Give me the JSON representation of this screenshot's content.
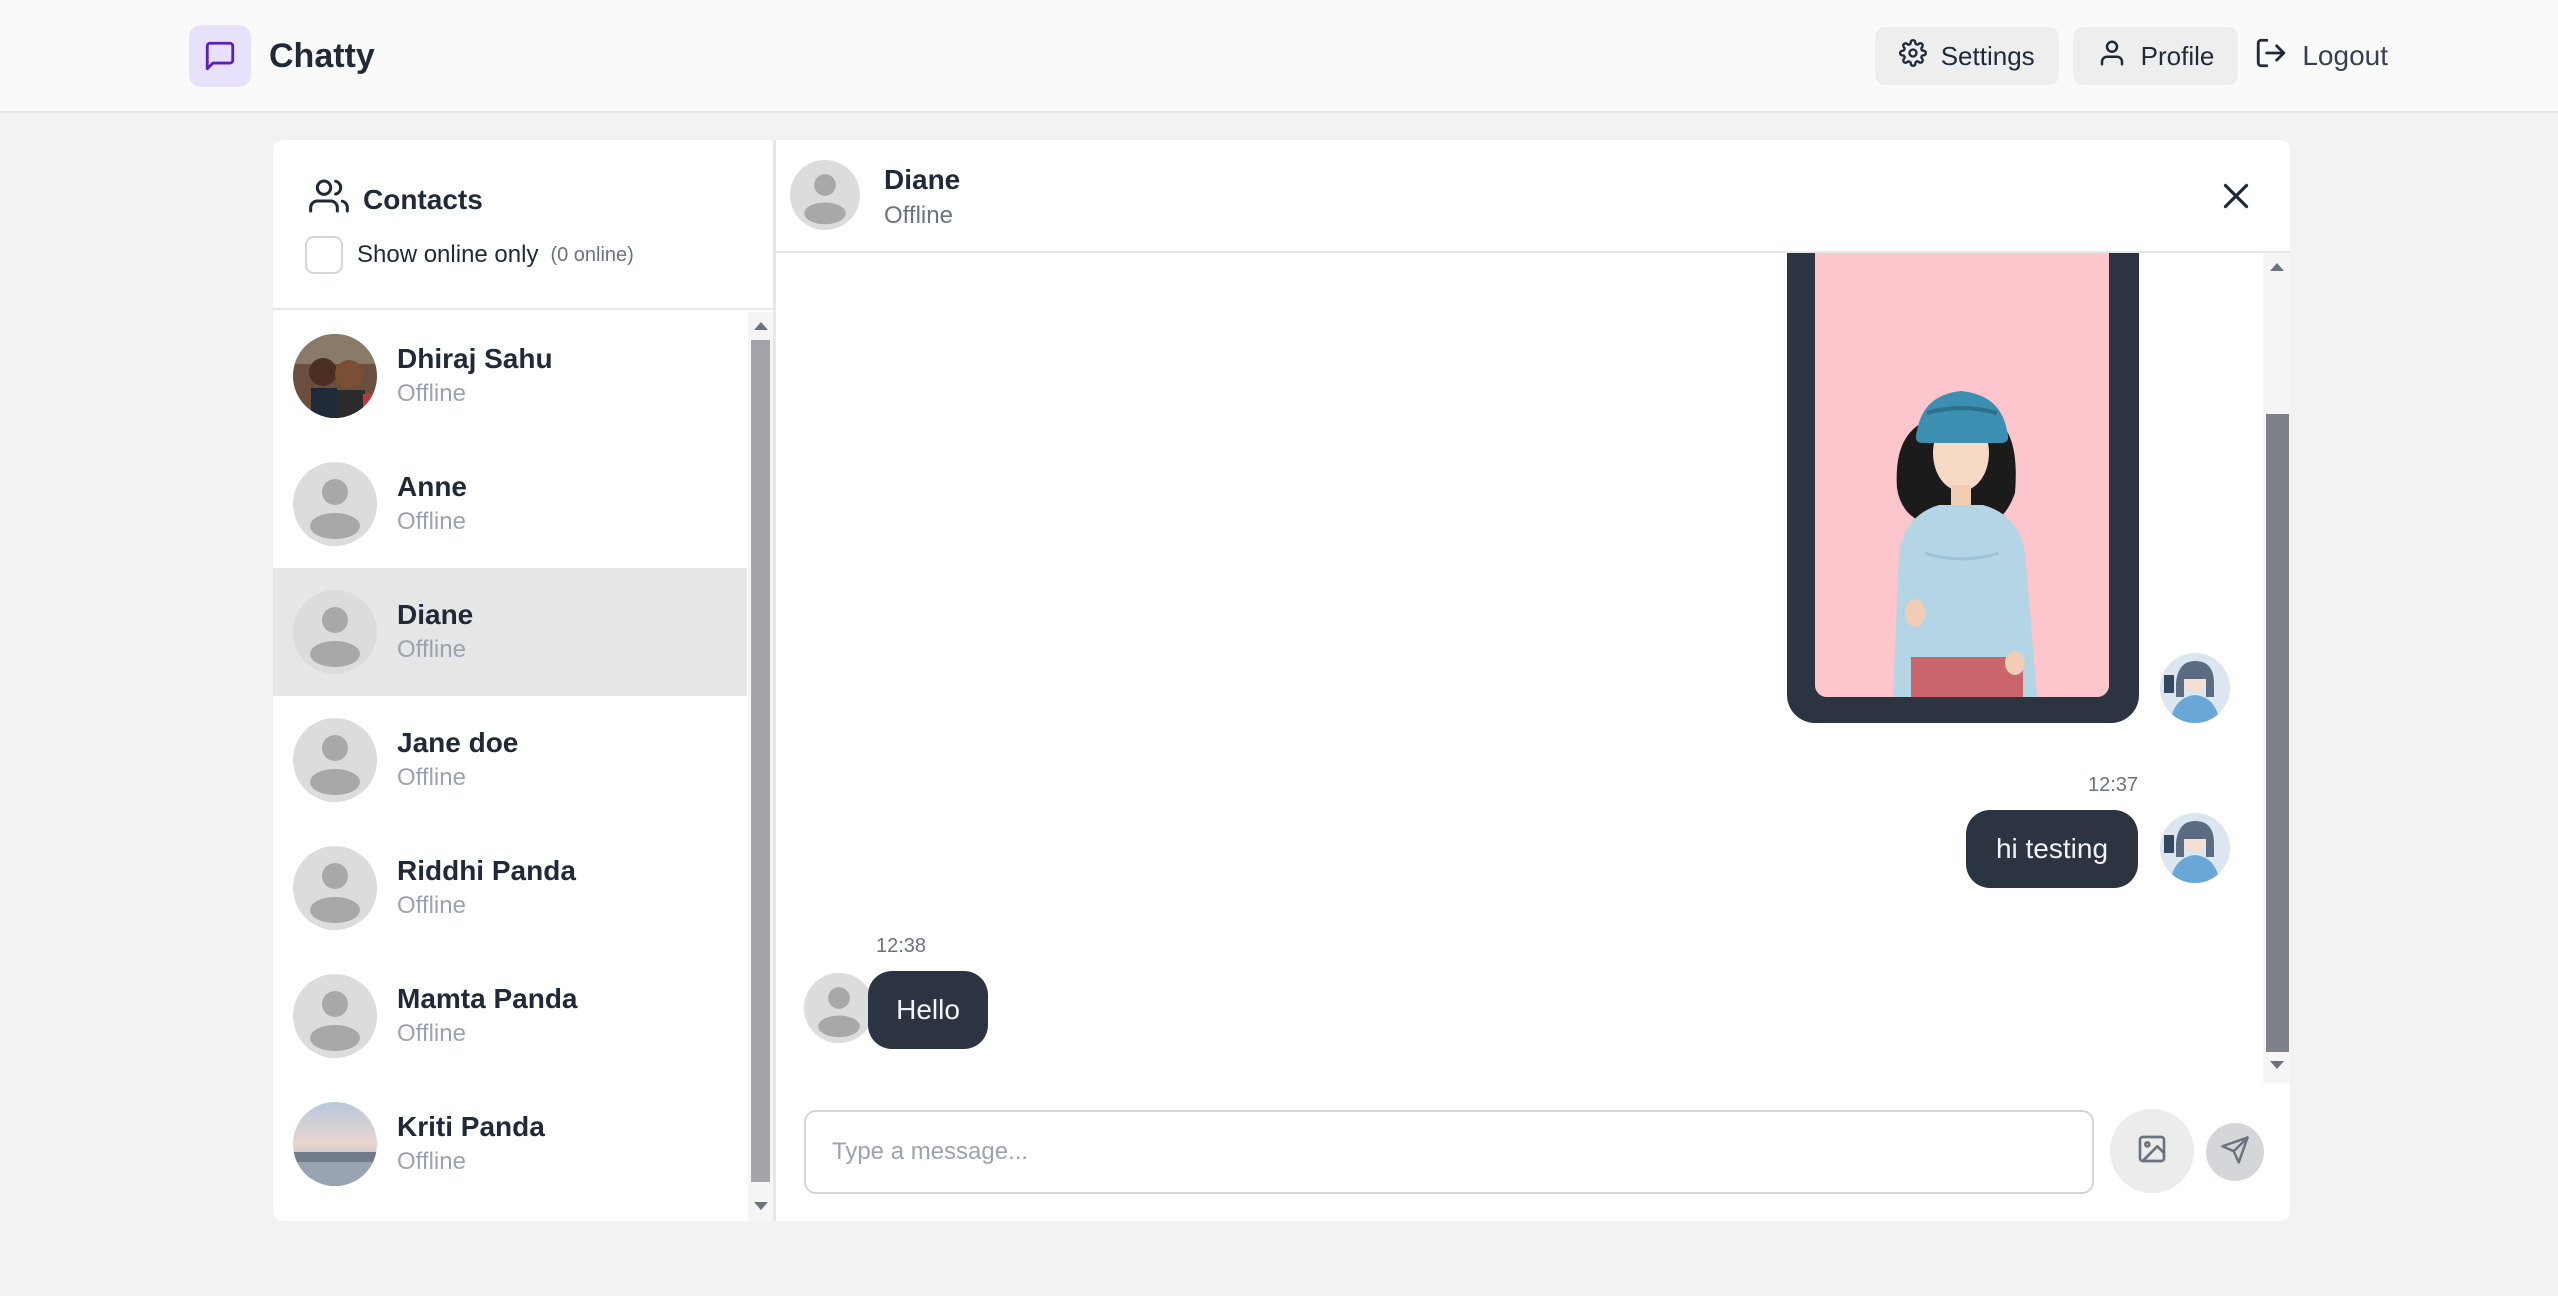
{
  "app": {
    "name": "Chatty"
  },
  "nav": {
    "settings_label": "Settings",
    "profile_label": "Profile",
    "logout_label": "Logout"
  },
  "sidebar": {
    "title": "Contacts",
    "online_filter_label": "Show online only",
    "online_count": "(0 online)",
    "contacts": [
      {
        "name": "Dhiraj Sahu",
        "status": "Offline",
        "avatar": "photo"
      },
      {
        "name": "Anne",
        "status": "Offline",
        "avatar": "default"
      },
      {
        "name": "Diane",
        "status": "Offline",
        "avatar": "default",
        "selected": true
      },
      {
        "name": "Jane doe",
        "status": "Offline",
        "avatar": "default"
      },
      {
        "name": "Riddhi Panda",
        "status": "Offline",
        "avatar": "default"
      },
      {
        "name": "Mamta Panda",
        "status": "Offline",
        "avatar": "default"
      },
      {
        "name": "Kriti Panda",
        "status": "Offline",
        "avatar": "photo"
      }
    ]
  },
  "chat": {
    "contact_name": "Diane",
    "contact_status": "Offline",
    "messages": [
      {
        "from": "me",
        "type": "image"
      },
      {
        "from": "me",
        "time": "12:37",
        "text": "hi testing"
      },
      {
        "from": "them",
        "time": "12:38",
        "text": "Hello"
      }
    ],
    "input_placeholder": "Type a message..."
  },
  "icons": {
    "brand": "message-square-icon",
    "settings": "gear-icon",
    "profile": "user-icon",
    "logout": "logout-icon",
    "contacts": "users-icon",
    "close": "close-icon",
    "attach": "image-icon",
    "send": "send-icon"
  },
  "colors": {
    "accent": "#5b21b6",
    "accent_bg": "#e8e1fb",
    "bubble": "#2d3441",
    "selected_row": "#e5e7e7"
  }
}
